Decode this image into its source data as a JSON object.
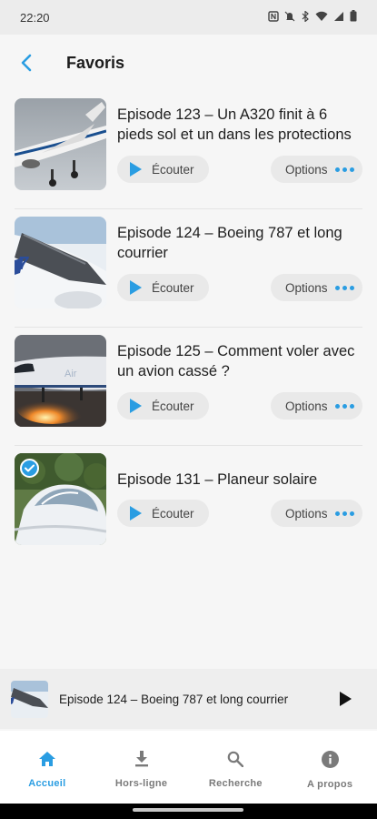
{
  "status_bar": {
    "time": "22:20"
  },
  "header": {
    "title": "Favoris"
  },
  "episodes": [
    {
      "title": "Episode 123 – Un A320 finit à 6 pieds sol et un dans les protections",
      "listen_label": "Écouter",
      "options_label": "Options",
      "selected": false
    },
    {
      "title": "Episode 124 – Boeing 787 et long courrier",
      "listen_label": "Écouter",
      "options_label": "Options",
      "selected": false
    },
    {
      "title": "Episode 125 – Comment voler avec un avion cassé ?",
      "listen_label": "Écouter",
      "options_label": "Options",
      "selected": false
    },
    {
      "title": "Episode 131 – Planeur solaire",
      "listen_label": "Écouter",
      "options_label": "Options",
      "selected": true
    }
  ],
  "mini_player": {
    "title": "Episode 124 – Boeing 787 et long courrier"
  },
  "bottom_nav": [
    {
      "label": "Accueil",
      "icon": "home-icon",
      "active": true
    },
    {
      "label": "Hors-ligne",
      "icon": "download-icon",
      "active": false
    },
    {
      "label": "Recherche",
      "icon": "search-icon",
      "active": false
    },
    {
      "label": "A propos",
      "icon": "info-icon",
      "active": false
    }
  ],
  "colors": {
    "accent": "#2a9de2",
    "background": "#f6f6f6",
    "pill": "#e9e9e9"
  }
}
